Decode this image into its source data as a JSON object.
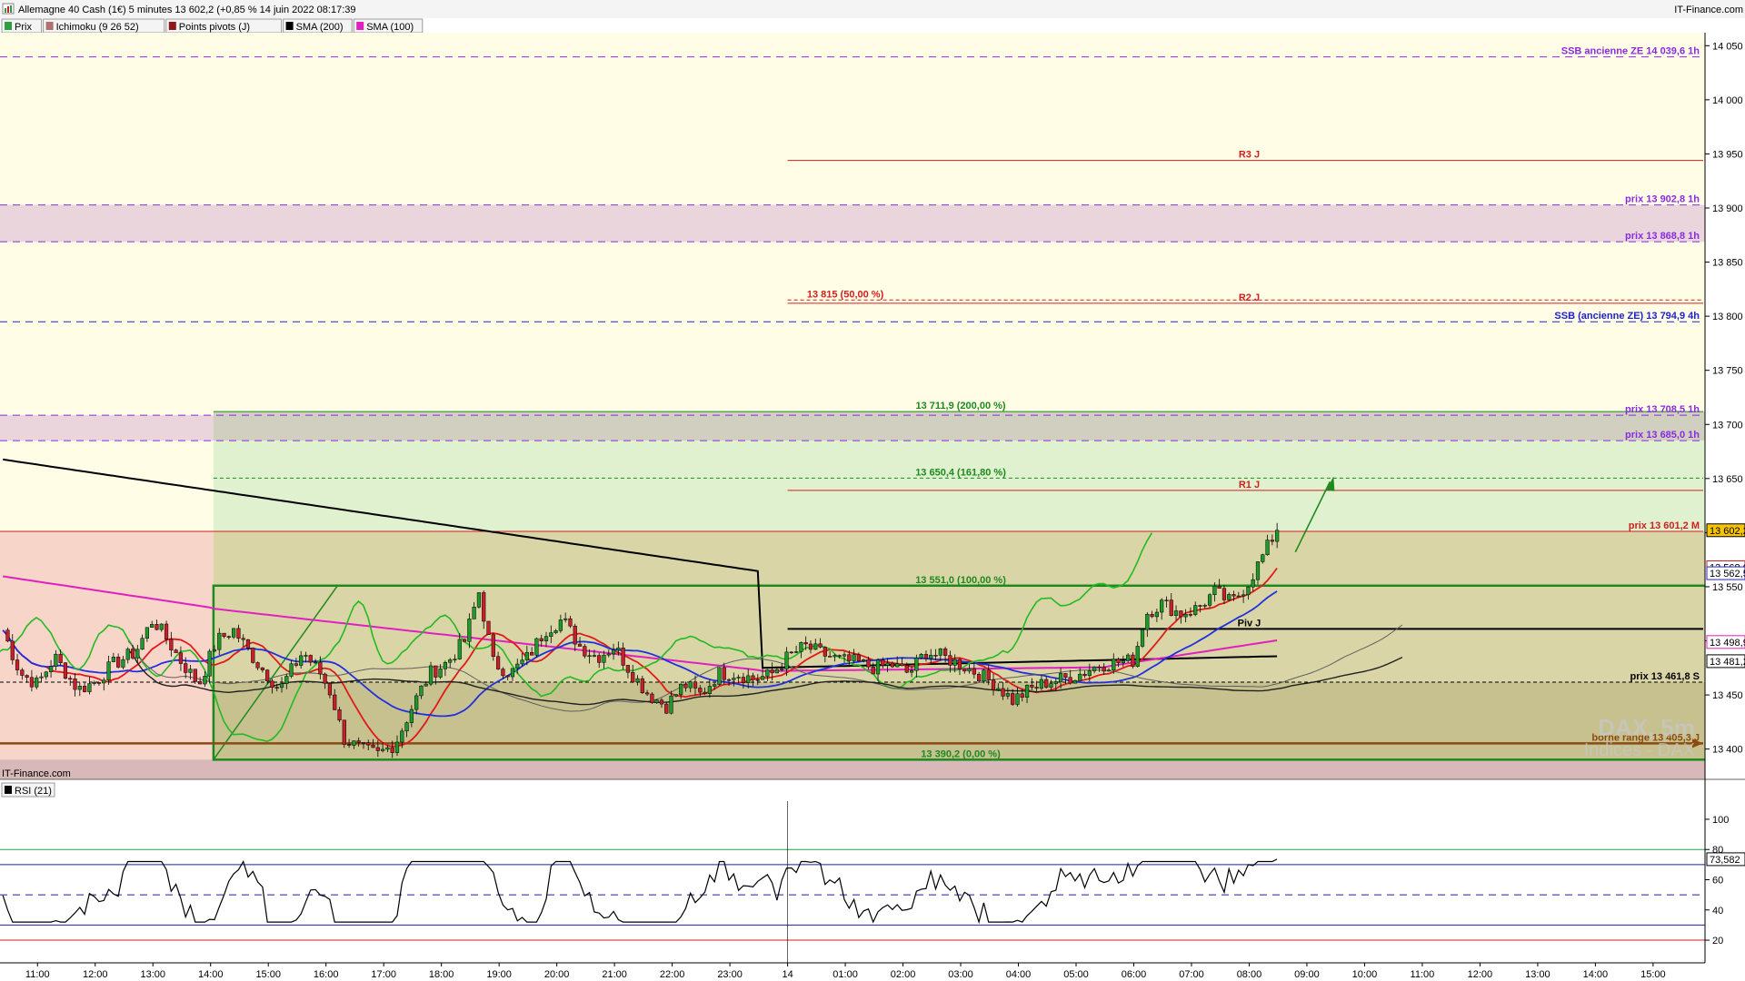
{
  "header": {
    "title": "Allemagne 40 Cash (1€) 5 minutes 13 602,2 (+0,85 % 14 juin 2022 08:17:39",
    "brand": "IT-Finance.com"
  },
  "legend": [
    {
      "label": "Prix",
      "color": "#2e9e3e"
    },
    {
      "label": "Ichimoku (9 26 52)",
      "color": "#b07070"
    },
    {
      "label": "Points pivots (J)",
      "color": "#8b1a1a"
    },
    {
      "label": "SMA (200)",
      "color": "#000000"
    },
    {
      "label": "SMA (100)",
      "color": "#e020c0"
    }
  ],
  "watermark": {
    "brand": "IT-Finance.com",
    "line1": "DAX, 5m",
    "line2": "Indices - DAX"
  },
  "rsi_panel": {
    "label": "RSI (21)",
    "current_label": "73,582"
  },
  "colors": {
    "bg_yellow": "#fffde6",
    "pink_zone": "#ead5dd",
    "gray_zone": "#d0cfc0",
    "green_zone": "#dff1cf",
    "red_zone": "#f7d5c8",
    "olive_zone": "#dad5a6",
    "dark_olive_zone": "#c6c18f",
    "range_box": "#1e8a1e",
    "up_candle": "#1f9a2a",
    "down_candle": "#c8202a"
  },
  "chart_data": {
    "type": "candlestick",
    "instrument": "Allemagne 40 Cash (1€)",
    "timeframe": "5 minutes",
    "last_price": 13602.2,
    "y_axis": {
      "range": [
        13372,
        14062
      ],
      "ticks": [
        "14 050",
        "14 000",
        "13 950",
        "13 900",
        "13 850",
        "13 800",
        "13 750",
        "13 700",
        "13 650",
        "13 600",
        "13 550",
        "13 500",
        "13 450",
        "13 400"
      ],
      "tick_values": [
        14050,
        14000,
        13950,
        13900,
        13850,
        13800,
        13750,
        13700,
        13650,
        13600,
        13550,
        13500,
        13450,
        13400
      ]
    },
    "x_axis": {
      "ticks": [
        "11:00",
        "12:00",
        "13:00",
        "14:00",
        "15:00",
        "16:00",
        "17:00",
        "18:00",
        "19:00",
        "20:00",
        "21:00",
        "22:00",
        "23:00",
        "14",
        "01:00",
        "02:00",
        "03:00",
        "04:00",
        "05:00",
        "06:00",
        "07:00",
        "08:00",
        "09:00",
        "10:00",
        "11:00",
        "12:00",
        "13:00",
        "14:00",
        "15:00"
      ],
      "tick_hours": [
        11,
        12,
        13,
        14,
        15,
        16,
        17,
        18,
        19,
        20,
        21,
        22,
        23,
        24,
        25,
        26,
        27,
        28,
        29,
        30,
        31,
        32,
        33,
        34,
        35,
        36,
        37,
        38,
        39
      ],
      "hour_range": [
        10.35,
        39.9
      ]
    },
    "price_path": [
      [
        10.4,
        13510
      ],
      [
        10.7,
        13470
      ],
      [
        11.0,
        13460
      ],
      [
        11.3,
        13485
      ],
      [
        11.7,
        13455
      ],
      [
        12.0,
        13462
      ],
      [
        12.3,
        13478
      ],
      [
        12.7,
        13490
      ],
      [
        13.0,
        13520
      ],
      [
        13.2,
        13505
      ],
      [
        13.5,
        13480
      ],
      [
        13.8,
        13460
      ],
      [
        14.1,
        13500
      ],
      [
        14.4,
        13510
      ],
      [
        14.8,
        13480
      ],
      [
        15.2,
        13455
      ],
      [
        15.6,
        13490
      ],
      [
        15.9,
        13470
      ],
      [
        16.1,
        13450
      ],
      [
        16.3,
        13410
      ],
      [
        16.6,
        13400
      ],
      [
        16.9,
        13395
      ],
      [
        17.2,
        13405
      ],
      [
        17.5,
        13440
      ],
      [
        17.8,
        13470
      ],
      [
        18.1,
        13480
      ],
      [
        18.4,
        13500
      ],
      [
        18.65,
        13545
      ],
      [
        18.9,
        13480
      ],
      [
        19.2,
        13470
      ],
      [
        19.5,
        13485
      ],
      [
        19.8,
        13510
      ],
      [
        20.1,
        13520
      ],
      [
        20.4,
        13495
      ],
      [
        20.7,
        13485
      ],
      [
        21.0,
        13495
      ],
      [
        21.3,
        13470
      ],
      [
        21.6,
        13450
      ],
      [
        21.9,
        13440
      ],
      [
        22.2,
        13460
      ],
      [
        22.5,
        13450
      ],
      [
        22.8,
        13470
      ],
      [
        23.1,
        13470
      ],
      [
        23.4,
        13465
      ],
      [
        23.7,
        13468
      ],
      [
        24.0,
        13485
      ],
      [
        24.3,
        13495
      ],
      [
        24.6,
        13488
      ],
      [
        24.9,
        13482
      ],
      [
        25.2,
        13480
      ],
      [
        25.5,
        13475
      ],
      [
        25.8,
        13478
      ],
      [
        26.1,
        13470
      ],
      [
        26.4,
        13490
      ],
      [
        26.7,
        13485
      ],
      [
        27.0,
        13478
      ],
      [
        27.3,
        13470
      ],
      [
        27.6,
        13460
      ],
      [
        27.9,
        13445
      ],
      [
        28.2,
        13455
      ],
      [
        28.5,
        13462
      ],
      [
        28.8,
        13465
      ],
      [
        29.1,
        13470
      ],
      [
        29.4,
        13478
      ],
      [
        29.7,
        13480
      ],
      [
        30.0,
        13482
      ],
      [
        30.2,
        13525
      ],
      [
        30.5,
        13535
      ],
      [
        30.8,
        13525
      ],
      [
        31.1,
        13530
      ],
      [
        31.4,
        13545
      ],
      [
        31.7,
        13535
      ],
      [
        32.0,
        13555
      ],
      [
        32.2,
        13575
      ],
      [
        32.4,
        13595
      ],
      [
        32.55,
        13602.2
      ]
    ],
    "levels": [
      {
        "label": "SSB ancienne ZE 14 039,6 1h",
        "value": 14039.6,
        "color": "#8a2be2",
        "style": "dashed"
      },
      {
        "label": "R3 J",
        "value": 13944,
        "color": "#d02020",
        "style": "solid"
      },
      {
        "label": "prix 13 902,8 1h",
        "value": 13902.8,
        "color": "#8a2be2",
        "style": "dashed"
      },
      {
        "label": "prix 13 868,8 1h",
        "value": 13868.8,
        "color": "#8a2be2",
        "style": "dashed"
      },
      {
        "label": "13 815 (50,00 %)",
        "value": 13815,
        "color": "#d02020",
        "style": "dashed"
      },
      {
        "label": "R2 J",
        "value": 13812,
        "color": "#d02020",
        "style": "solid"
      },
      {
        "label": "SSB (ancienne ZE) 13 794,9 4h",
        "value": 13794.9,
        "color": "#2020d0",
        "style": "dashed"
      },
      {
        "label": "13 711,9 (200,00 %)",
        "value": 13711.9,
        "color": "#1e8a1e",
        "style": "solid"
      },
      {
        "label": "prix 13 708,5 1h",
        "value": 13708.5,
        "color": "#8a2be2",
        "style": "dashed"
      },
      {
        "label": "prix 13 685,0 1h",
        "value": 13685.0,
        "color": "#8a2be2",
        "style": "dashed"
      },
      {
        "label": "13 650,4 (161,80 %)",
        "value": 13650.4,
        "color": "#1e8a1e",
        "style": "dashed"
      },
      {
        "label": "R1 J",
        "value": 13639,
        "color": "#d02020",
        "style": "solid"
      },
      {
        "label": "prix 13 601,2 M",
        "value": 13601.2,
        "color": "#d02020",
        "style": "solid"
      },
      {
        "label": "13 551,0 (100,00 %)",
        "value": 13551.0,
        "color": "#1e8a1e",
        "style": "solid"
      },
      {
        "label": "Piv J",
        "value": 13511,
        "color": "#000000",
        "style": "solid"
      },
      {
        "label": "prix 13 461,8 S",
        "value": 13461.8,
        "color": "#000000",
        "style": "dashed"
      },
      {
        "label": "borne range 13 405,3 J",
        "value": 13405.3,
        "color": "#8b4a10",
        "style": "solid"
      },
      {
        "label": "13 390,2 (0,00 %)",
        "value": 13390.2,
        "color": "#1e8a1e",
        "style": "solid"
      }
    ],
    "price_tags": [
      {
        "label": "13 602,2",
        "value": 13602.2,
        "bg": "#f6c400",
        "fg": "#000000"
      },
      {
        "label": "13 568,0",
        "value": 13568.0,
        "bg": "#ffffff",
        "fg": "#d02020"
      },
      {
        "label": "13 562,5",
        "value": 13562.5,
        "bg": "#ffffff",
        "fg": "#2020d0"
      },
      {
        "label": "13 498,9",
        "value": 13498.9,
        "bg": "#ffffff",
        "fg": "#e020c0"
      },
      {
        "label": "13 481,2",
        "value": 13481.2,
        "bg": "#ffffff",
        "fg": "#000000"
      }
    ],
    "rsi": {
      "y_range": [
        5,
        112
      ],
      "ticks": [
        "100",
        "80",
        "60",
        "40",
        "20"
      ],
      "tick_values": [
        100,
        80,
        60,
        40,
        20
      ],
      "levels": [
        {
          "value": 80,
          "color": "#2e9e3e"
        },
        {
          "value": 70,
          "color": "#2020a0"
        },
        {
          "value": 50,
          "color": "#2020a0"
        },
        {
          "value": 30,
          "color": "#2020a0"
        },
        {
          "value": 20,
          "color": "#d02020"
        }
      ],
      "current": 73.582
    }
  }
}
